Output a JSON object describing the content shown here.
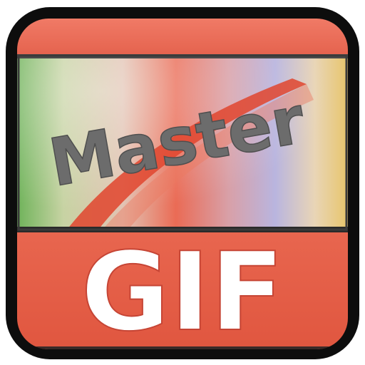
{
  "icon": {
    "top_word": "Master",
    "bottom_word": "GIF",
    "colors": {
      "outline": "#0d0d0d",
      "top_band": "#e96a58",
      "bottom_panel": "#e2604a",
      "panel_border": "#2a2a2a",
      "gif_text": "#ffffff",
      "master_text": "#6c6c6c",
      "swoosh": "#e0452e",
      "rainbow": [
        "#6fb35a",
        "#cfd3a0",
        "#ea6b55",
        "#b9b5df",
        "#efd89a",
        "#e7c56b"
      ]
    }
  }
}
